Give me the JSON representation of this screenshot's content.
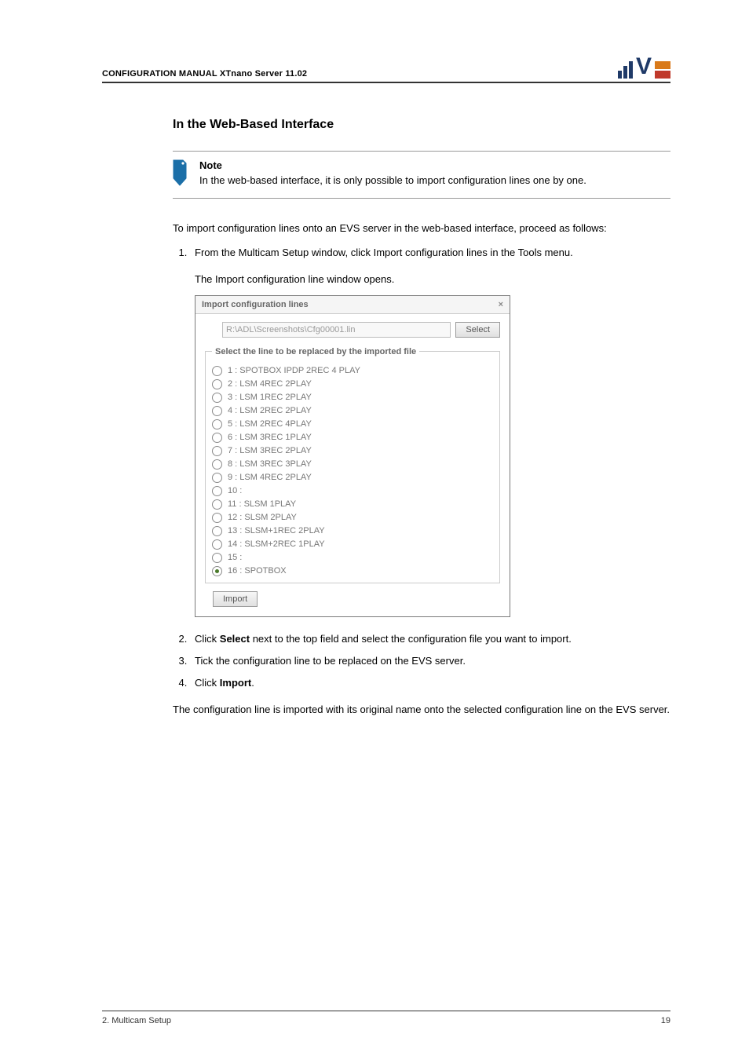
{
  "header": {
    "title": "CONFIGURATION MANUAL   XTnano Server 11.02"
  },
  "section_heading": "In the Web-Based Interface",
  "note": {
    "label": "Note",
    "body": "In the web-based interface, it is only possible to import configuration lines one by one."
  },
  "intro": "To import configuration lines onto an EVS server in the web-based interface, proceed as follows:",
  "step1": "From the Multicam Setup window, click Import configuration lines in the Tools menu.",
  "step1_sub": "The Import configuration line window opens.",
  "dialog": {
    "title": "Import configuration lines",
    "close": "×",
    "path": "R:\\ADL\\Screenshots\\Cfg00001.lin",
    "select_btn": "Select",
    "legend": "Select the line to be replaced by the imported file",
    "lines": [
      {
        "label": "1 : SPOTBOX IPDP 2REC 4 PLAY",
        "selected": false
      },
      {
        "label": "2 : LSM 4REC 2PLAY",
        "selected": false
      },
      {
        "label": "3 : LSM 1REC 2PLAY",
        "selected": false
      },
      {
        "label": "4 : LSM 2REC 2PLAY",
        "selected": false
      },
      {
        "label": "5 : LSM 2REC 4PLAY",
        "selected": false
      },
      {
        "label": "6 : LSM 3REC 1PLAY",
        "selected": false
      },
      {
        "label": "7 : LSM 3REC 2PLAY",
        "selected": false
      },
      {
        "label": "8 : LSM 3REC 3PLAY",
        "selected": false
      },
      {
        "label": "9 : LSM 4REC 2PLAY",
        "selected": false
      },
      {
        "label": "10 :",
        "selected": false
      },
      {
        "label": "11 : SLSM 1PLAY",
        "selected": false
      },
      {
        "label": "12 : SLSM 2PLAY",
        "selected": false
      },
      {
        "label": "13 : SLSM+1REC 2PLAY",
        "selected": false
      },
      {
        "label": "14 : SLSM+2REC 1PLAY",
        "selected": false
      },
      {
        "label": "15 :",
        "selected": false
      },
      {
        "label": "16 : SPOTBOX",
        "selected": true
      }
    ],
    "import_btn": "Import"
  },
  "step2_pre": "Click ",
  "step2_bold": "Select",
  "step2_post": " next to the top field and select the configuration file you want to import.",
  "step3": "Tick the configuration line to be replaced on the EVS server.",
  "step4_pre": "Click ",
  "step4_bold": "Import",
  "step4_post": ".",
  "closing": "The configuration line is imported with its original name onto the selected configuration line on the EVS server.",
  "footer": {
    "left": "2. Multicam Setup",
    "right": "19"
  }
}
